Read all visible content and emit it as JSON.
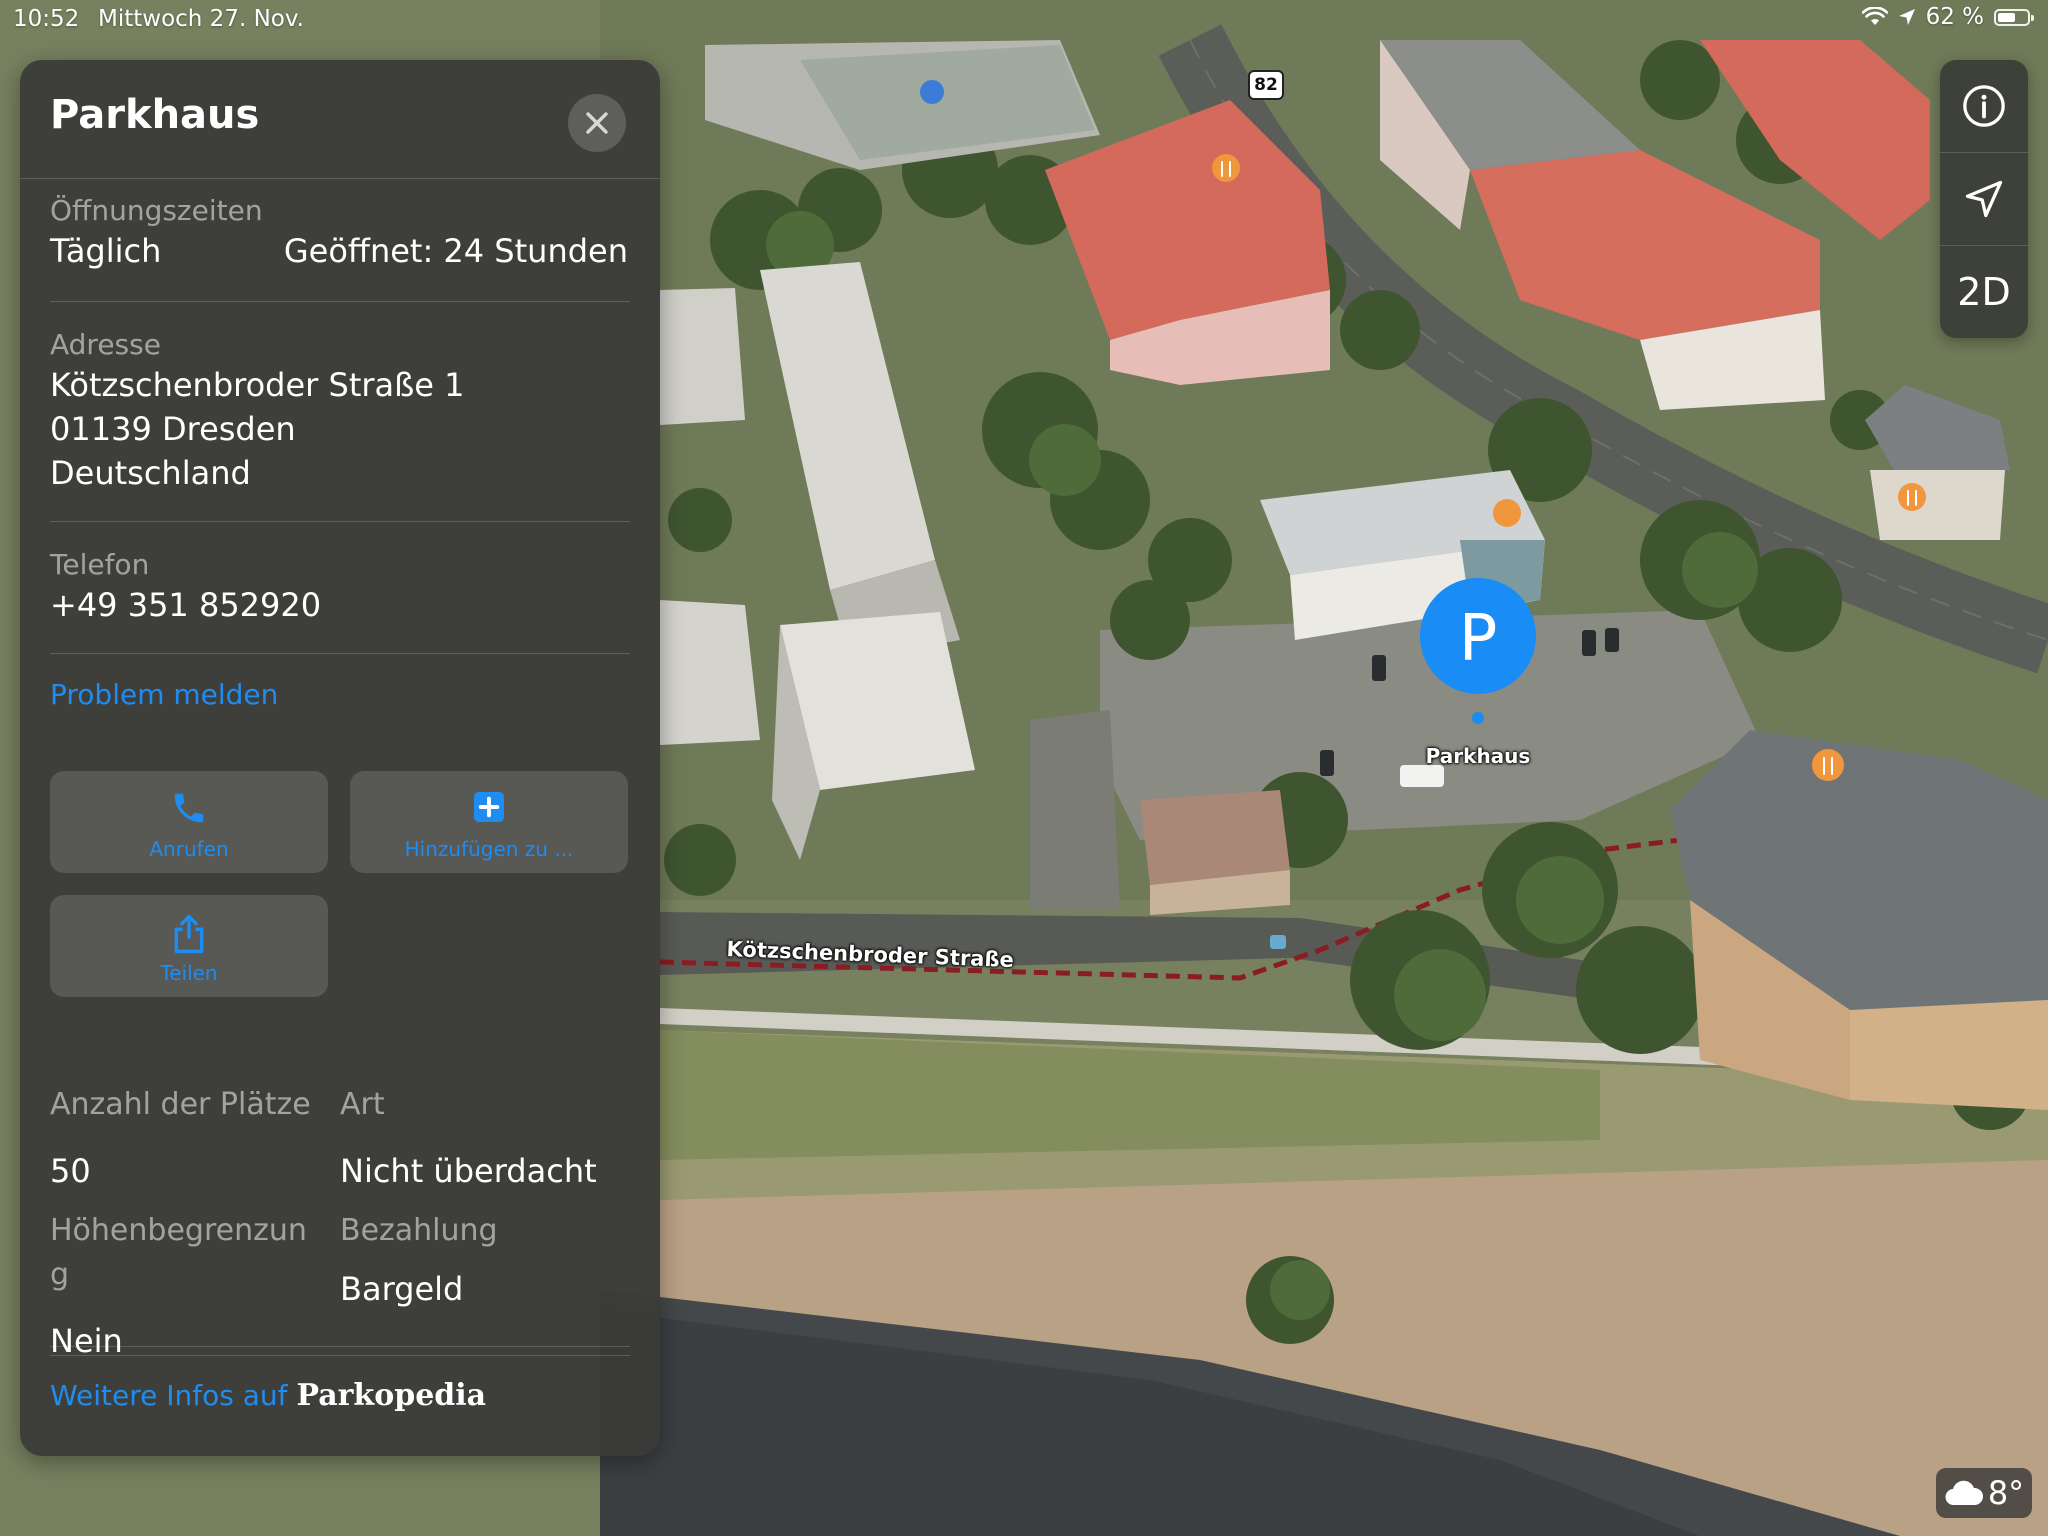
{
  "status_bar": {
    "time": "10:52",
    "date": "Mittwoch 27. Nov.",
    "battery": "62 %",
    "battery_level": 0.62
  },
  "panel": {
    "title": "Parkhaus",
    "hours": {
      "label": "Öffnungszeiten",
      "day": "Täglich",
      "value": "Geöffnet: 24 Stunden"
    },
    "address": {
      "label": "Adresse",
      "line1": "Kötzschenbroder Straße 1",
      "line2": "01139 Dresden",
      "line3": "Deutschland"
    },
    "phone": {
      "label": "Telefon",
      "value": "+49 351 852920"
    },
    "report_link": "Problem melden",
    "actions": {
      "call": "Anrufen",
      "add": "Hinzufügen zu ...",
      "share": "Teilen"
    },
    "details": {
      "spots_label": "Anzahl der Plätze",
      "spots_value": "50",
      "type_label": "Art",
      "type_value": "Nicht überdacht",
      "height_label": "Höhenbegrenzun g",
      "height_value": "Nein",
      "payment_label": "Bezahlung",
      "payment_value": "Bargeld"
    },
    "more_info_prefix": "Weitere Infos auf",
    "more_info_brand": "Parkopedia"
  },
  "controls": {
    "info": "info-icon",
    "location": "location-arrow-icon",
    "mode_label": "2D"
  },
  "map": {
    "pin_glyph": "P",
    "pin_label": "Parkhaus",
    "street_label": "Kötzschenbroder Straße",
    "route_shield": "82",
    "pin_color": "#1a8cf5",
    "poi_color": "#f0963c"
  },
  "weather": {
    "temperature": "8°",
    "icon": "cloud-icon"
  }
}
